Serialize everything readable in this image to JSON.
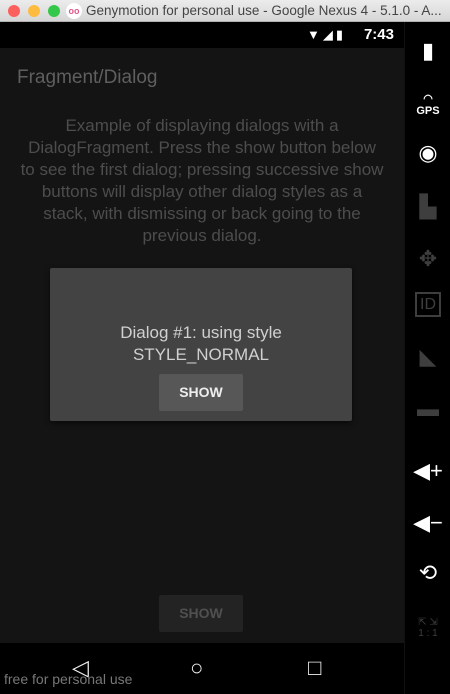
{
  "window": {
    "title": "Genymotion for personal use - Google Nexus 4 - 5.1.0 - A...",
    "app_logo": "oo",
    "colors": {
      "close": "#fc605c",
      "minimize": "#fdbc40",
      "zoom": "#34c84a"
    }
  },
  "status_bar": {
    "time": "7:43",
    "icons": [
      "wifi-icon",
      "signal-icon",
      "battery-charging-icon"
    ]
  },
  "app": {
    "title": "Fragment/Dialog",
    "description": "Example of displaying dialogs with a DialogFragment.  Press the show button below to see the first dialog; pressing successive show buttons will display other dialog styles as a stack, with dismissing or back going to the previous dialog.",
    "dialog": {
      "line1": "Dialog #1: using style",
      "line2": "STYLE_NORMAL",
      "button": "SHOW"
    },
    "bottom_button": "SHOW"
  },
  "sidebar": {
    "gps_label": "GPS",
    "scale_label": "1 : 1",
    "items": [
      "battery-icon",
      "gps-icon",
      "webcam-icon",
      "capture-icon",
      "dpad-icon",
      "id-icon",
      "cast-icon",
      "sms-icon",
      "volume-up-icon",
      "volume-down-icon",
      "rotate-icon",
      "pixel-perfect-icon"
    ]
  },
  "nav": {
    "watermark": "free for personal use"
  }
}
